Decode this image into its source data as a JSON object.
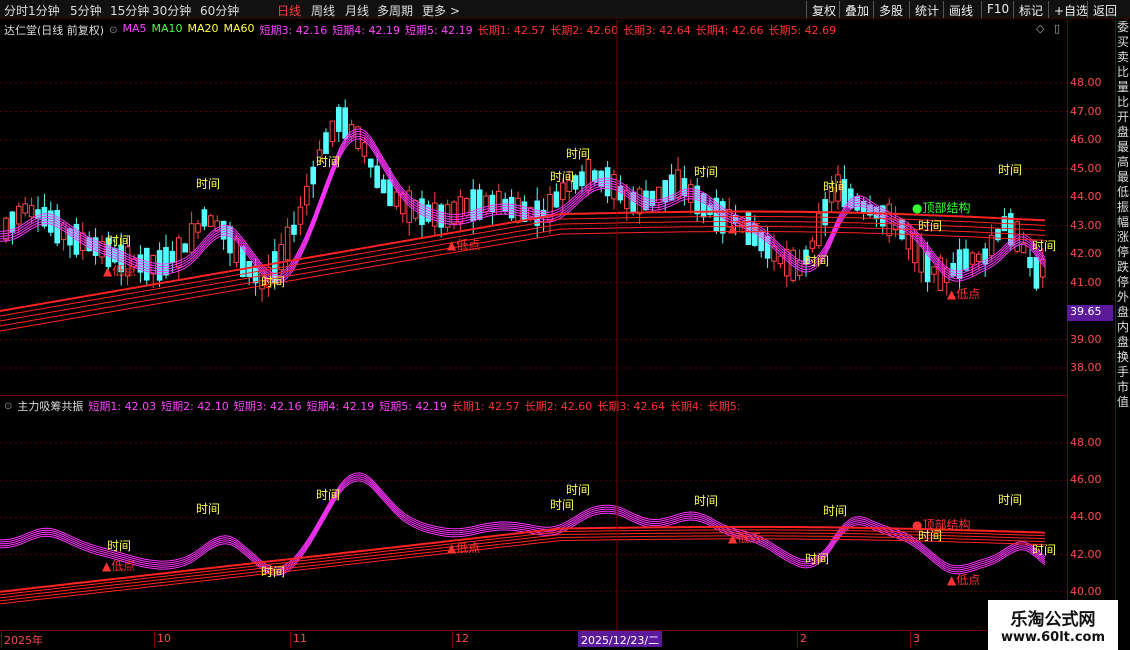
{
  "toolbar": {
    "periods": [
      "分时",
      "1分钟",
      "5分钟",
      "15分钟",
      "30分钟",
      "60分钟",
      "日线",
      "周线",
      "月线",
      "多周期",
      "更多 >"
    ],
    "active_period": "日线",
    "buttons": [
      "复权",
      "叠加",
      "多股",
      "统计",
      "画线",
      "F10",
      "标记",
      "+自选",
      "返回"
    ]
  },
  "main_chart": {
    "title": "达仁堂(日线 前复权)",
    "legend": [
      {
        "label": "MA5",
        "color": "#ff44ff"
      },
      {
        "label": "MA10",
        "color": "#44ff44"
      },
      {
        "label": "MA20",
        "color": "#ffff44"
      },
      {
        "label": "MA60",
        "color": "#ffff44"
      },
      {
        "label": "短期3: 42.16",
        "color": "#ff44ff"
      },
      {
        "label": "短期4: 42.19",
        "color": "#ff44ff"
      },
      {
        "label": "短期5: 42.19",
        "color": "#ff44ff"
      },
      {
        "label": "长期1: 42.57",
        "color": "#ff3333"
      },
      {
        "label": "长期2: 42.60",
        "color": "#ff3333"
      },
      {
        "label": "长期3: 42.64",
        "color": "#ff3333"
      },
      {
        "label": "长期4: 42.66",
        "color": "#ff3333"
      },
      {
        "label": "长期5: 42.69",
        "color": "#ff3333"
      }
    ],
    "price_ticks": [
      "48.00",
      "47.00",
      "46.00",
      "45.00",
      "44.00",
      "43.00",
      "42.00",
      "41.00",
      "39.00",
      "38.00"
    ],
    "current_price": "39.65",
    "annotations": {
      "time": "时间",
      "low": "▲低点",
      "top": "●顶部结构"
    }
  },
  "indicator": {
    "title": "主力吸筹共振",
    "legend": [
      {
        "label": "短期1: 42.03",
        "color": "#ff44ff"
      },
      {
        "label": "短期2: 42.10",
        "color": "#ff44ff"
      },
      {
        "label": "短期3: 42.16",
        "color": "#ff44ff"
      },
      {
        "label": "短期4: 42.19",
        "color": "#ff44ff"
      },
      {
        "label": "短期5: 42.19",
        "color": "#ff44ff"
      },
      {
        "label": "长期1: 42.57",
        "color": "#ff3333"
      },
      {
        "label": "长期2: 42.60",
        "color": "#ff3333"
      },
      {
        "label": "长期3: 42.64",
        "color": "#ff3333"
      },
      {
        "label": "长期4:",
        "color": "#ff3333"
      },
      {
        "label": "长期5:",
        "color": "#ff3333"
      }
    ],
    "ticks": [
      "48.00",
      "46.00",
      "44.00",
      "42.00",
      "40.00"
    ]
  },
  "date_axis": {
    "labels": [
      "2025年",
      "10",
      "11",
      "12",
      "2",
      "3"
    ],
    "cursor_date": "2025/12/23/二"
  },
  "right_strip": {
    "chars": "委买卖比量比开盘最高最低振幅涨停跌停外盘内盘换手市值",
    "label2": "自选"
  },
  "watermark": {
    "title": "乐淘公式网",
    "url": "www.60lt.com"
  },
  "colors": {
    "up": "#ff4444",
    "down": "#55ffff",
    "short": "#ff33ff",
    "long": "#ff2222",
    "time_label": "#ffff55",
    "low_label": "#ff3333",
    "top_label": "#33ff33"
  }
}
